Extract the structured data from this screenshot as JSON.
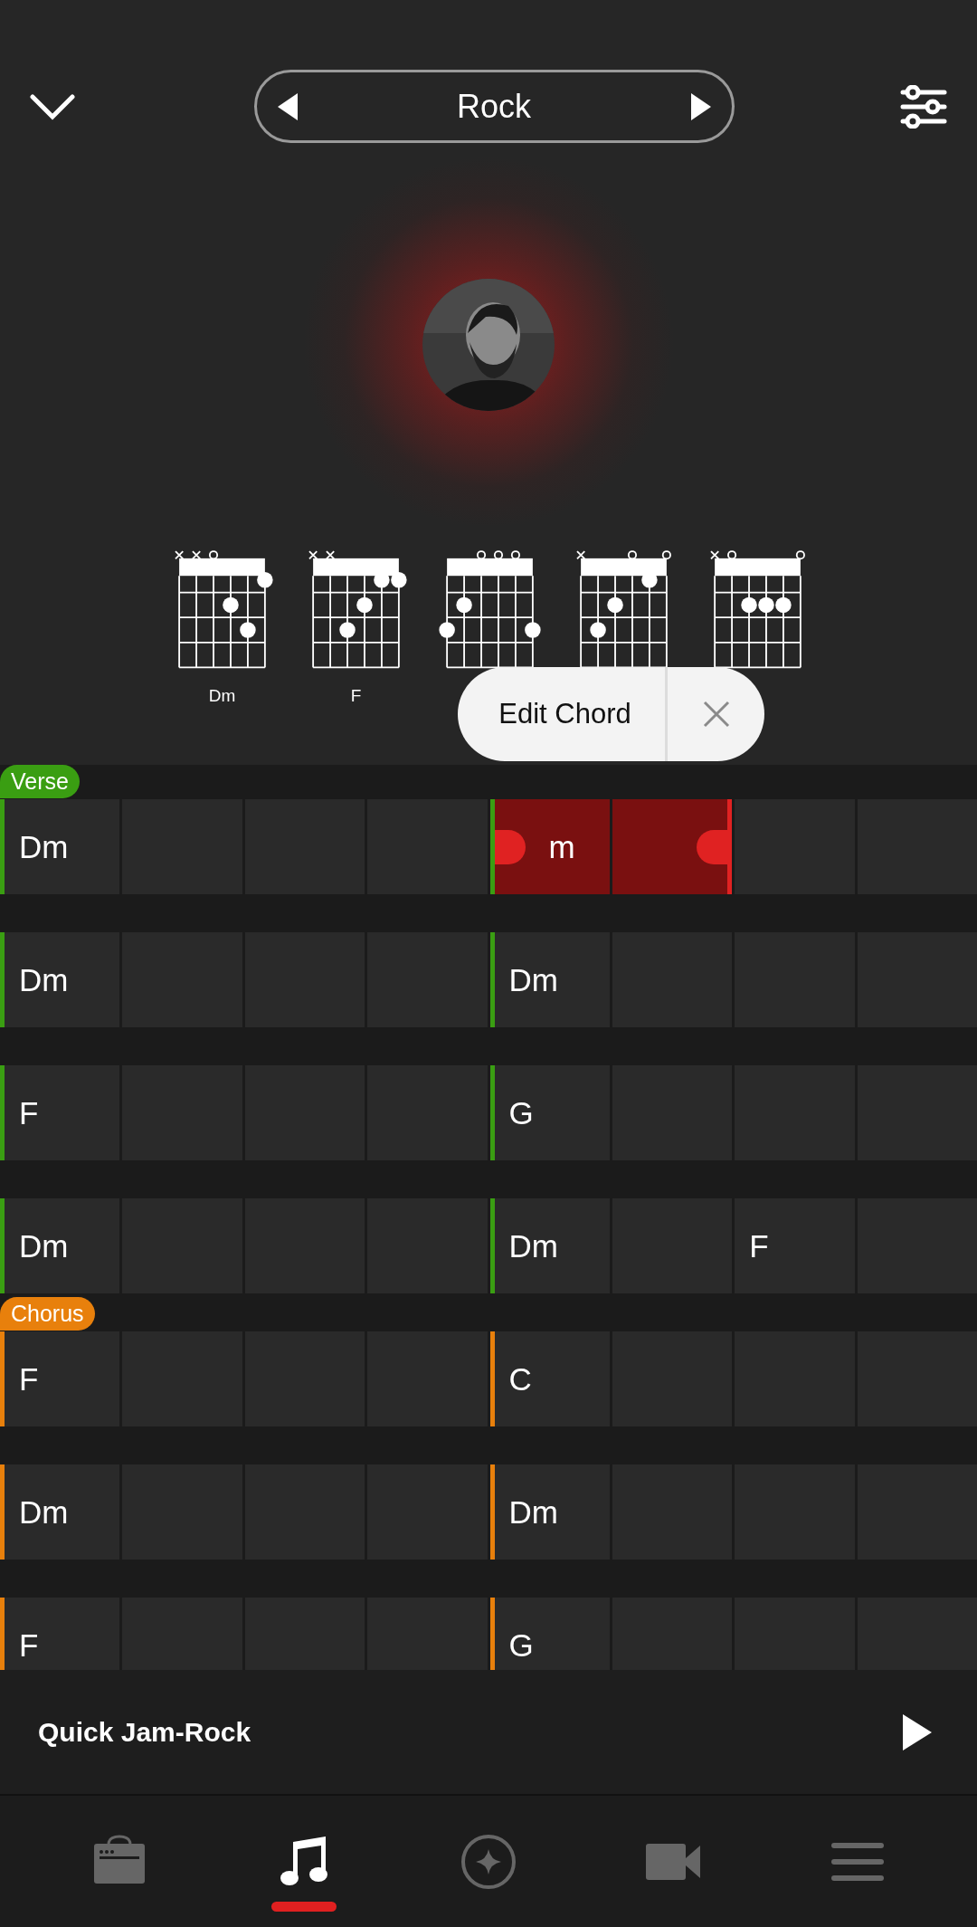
{
  "style_selector": {
    "label": "Rock"
  },
  "chords": [
    {
      "strings": [
        {
          "kind": "muted"
        },
        {
          "kind": "muted"
        },
        {
          "kind": "open"
        },
        {
          "kind": "fret2"
        },
        {
          "kind": "fret3"
        },
        {
          "kind": "fret1"
        }
      ],
      "label": "Dm"
    },
    {
      "strings": [
        {
          "kind": "muted"
        },
        {
          "kind": "muted"
        },
        {
          "kind": "fret3"
        },
        {
          "kind": "fret2"
        },
        {
          "kind": "fret1"
        },
        {
          "kind": "fret1"
        }
      ],
      "label": "F"
    },
    {
      "strings": [
        {
          "kind": "fret3"
        },
        {
          "kind": "fret2"
        },
        {
          "kind": "open"
        },
        {
          "kind": "open"
        },
        {
          "kind": "open"
        },
        {
          "kind": "fret3"
        }
      ]
    },
    {
      "strings": [
        {
          "kind": "muted"
        },
        {
          "kind": "fret3"
        },
        {
          "kind": "fret2"
        },
        {
          "kind": "open"
        },
        {
          "kind": "fret1"
        },
        {
          "kind": "open"
        }
      ]
    },
    {
      "strings": [
        {
          "kind": "muted"
        },
        {
          "kind": "open"
        },
        {
          "kind": "fret2"
        },
        {
          "kind": "fret2"
        },
        {
          "kind": "fret2"
        },
        {
          "kind": "open"
        }
      ]
    }
  ],
  "popup": {
    "label": "Edit Chord"
  },
  "sections": [
    {
      "name": "Verse",
      "color": "#3a9e12",
      "rows": [
        {
          "cells": [
            {
              "chord": "Dm",
              "selected": false
            },
            {
              "selected": false
            },
            {
              "selected": false
            },
            {
              "selected": false
            },
            {
              "chord": "m",
              "selected": true
            },
            {
              "selected": true
            },
            {
              "selected": false
            },
            {
              "selected": false
            }
          ]
        },
        {
          "cells": [
            {
              "chord": "Dm",
              "selected": false
            },
            {
              "selected": false
            },
            {
              "selected": false
            },
            {
              "selected": false
            },
            {
              "chord": "Dm",
              "selected": false
            },
            {
              "selected": false
            },
            {
              "selected": false
            },
            {
              "selected": false
            }
          ]
        },
        {
          "cells": [
            {
              "chord": "F",
              "selected": false
            },
            {
              "selected": false
            },
            {
              "selected": false
            },
            {
              "selected": false
            },
            {
              "chord": "G",
              "selected": false
            },
            {
              "selected": false
            },
            {
              "selected": false
            },
            {
              "selected": false
            }
          ]
        },
        {
          "cells": [
            {
              "chord": "Dm",
              "selected": false
            },
            {
              "selected": false
            },
            {
              "selected": false
            },
            {
              "selected": false
            },
            {
              "chord": "Dm",
              "selected": false
            },
            {
              "selected": false
            },
            {
              "chord": "F",
              "selected": false
            },
            {
              "selected": false
            }
          ]
        }
      ]
    },
    {
      "name": "Chorus",
      "color": "#e8800c",
      "rows": [
        {
          "cells": [
            {
              "chord": "F",
              "selected": false
            },
            {
              "selected": false
            },
            {
              "selected": false
            },
            {
              "selected": false
            },
            {
              "chord": "C",
              "selected": false
            },
            {
              "selected": false
            },
            {
              "selected": false
            },
            {
              "selected": false
            }
          ]
        },
        {
          "cells": [
            {
              "chord": "Dm",
              "selected": false
            },
            {
              "selected": false
            },
            {
              "selected": false
            },
            {
              "selected": false
            },
            {
              "chord": "Dm",
              "selected": false
            },
            {
              "selected": false
            },
            {
              "selected": false
            },
            {
              "selected": false
            }
          ]
        },
        {
          "cells": [
            {
              "chord": "F",
              "selected": false
            },
            {
              "selected": false
            },
            {
              "selected": false
            },
            {
              "selected": false
            },
            {
              "chord": "G",
              "selected": false
            },
            {
              "selected": false
            },
            {
              "selected": false
            },
            {
              "selected": false
            }
          ]
        }
      ]
    }
  ],
  "player": {
    "title": "Quick Jam-Rock"
  },
  "nav": [
    {
      "kind": "amp",
      "selected": false
    },
    {
      "kind": "music",
      "selected": true
    },
    {
      "kind": "discover",
      "selected": false
    },
    {
      "kind": "video",
      "selected": false
    },
    {
      "kind": "menu",
      "selected": false
    }
  ]
}
